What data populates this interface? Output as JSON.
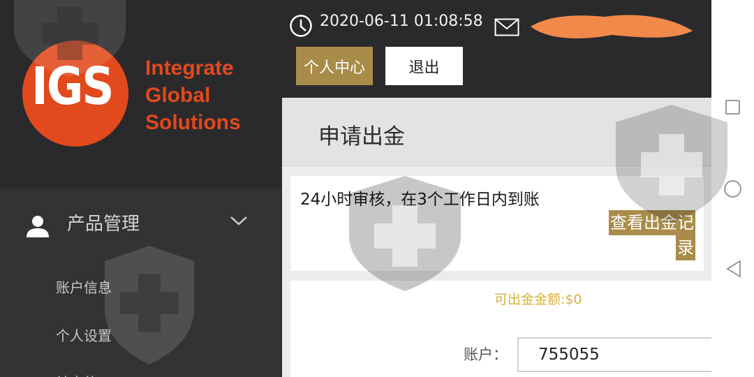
{
  "logo": {
    "letters": "IGS",
    "line1": "Integrate",
    "line2": "Global",
    "line3": "Solutions"
  },
  "sidebar": {
    "section_label": "产品管理",
    "items": [
      {
        "label": "账户信息"
      },
      {
        "label": "个人设置"
      },
      {
        "label": "转去的"
      }
    ]
  },
  "header": {
    "datetime": "2020-06-11 01:08:58",
    "user_center": "个人中心",
    "logout": "退出"
  },
  "page": {
    "title": "申请出金",
    "notice": "24小时审核，在3个工作日内到账",
    "records_line1": "查看出金记",
    "records_line2": "录",
    "balance": "可出金金额:$0",
    "account_label": "账户：",
    "account_value": "755055"
  },
  "colors": {
    "accent_gold": "#a98c4a",
    "logo_orange": "#e2491c",
    "balance_yellow": "#d8b23c",
    "redaction_orange": "#f0894a"
  },
  "icons": [
    "clock-icon",
    "mail-icon",
    "user-icon",
    "chevron-down-icon",
    "nav-recents-icon",
    "nav-home-icon",
    "nav-back-icon"
  ]
}
